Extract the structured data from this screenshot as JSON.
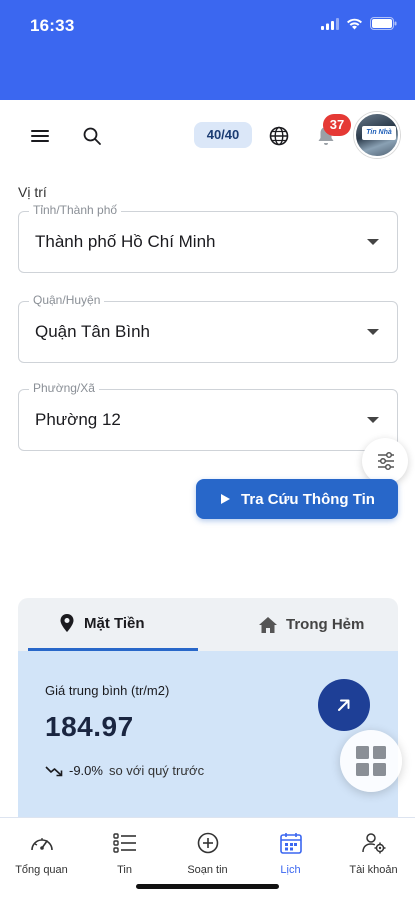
{
  "status_bar": {
    "time": "16:33"
  },
  "header": {
    "credits": "40/40",
    "notification_count": "37",
    "avatar_logo_text": "Tin Nhà"
  },
  "location": {
    "section_label": "Vị trí",
    "province": {
      "legend": "Tỉnh/Thành phố",
      "value": "Thành phố Hồ Chí Minh"
    },
    "district": {
      "legend": "Quận/Huyện",
      "value": "Quận Tân Bình"
    },
    "ward": {
      "legend": "Phường/Xã",
      "value": "Phường 12"
    }
  },
  "search_button": {
    "label": "Tra Cứu Thông Tin"
  },
  "price_card": {
    "tabs": [
      {
        "label": "Mặt Tiền",
        "icon": "location-pin-icon",
        "active": true
      },
      {
        "label": "Trong Hẻm",
        "icon": "home-icon",
        "active": false
      }
    ],
    "avg_label": "Giá trung bình (tr/m2)",
    "avg_value": "184.97",
    "change_pct": "-9.0%",
    "change_text": "so với quý trước"
  },
  "bottom_nav": [
    {
      "label": "Tổng quan",
      "icon": "dashboard-gauge-icon",
      "active": false
    },
    {
      "label": "Tin",
      "icon": "list-icon",
      "active": false
    },
    {
      "label": "Soạn tin",
      "icon": "add-circle-icon",
      "active": false
    },
    {
      "label": "Lịch",
      "icon": "calendar-icon",
      "active": true
    },
    {
      "label": "Tài khoản",
      "icon": "account-gear-icon",
      "active": false
    }
  ],
  "colors": {
    "status_bar": "#3b67f0",
    "primary_button": "#2867c9",
    "panel_bg": "#d2e4f8",
    "badge_red": "#e53935",
    "active_nav": "#3b67f0"
  }
}
